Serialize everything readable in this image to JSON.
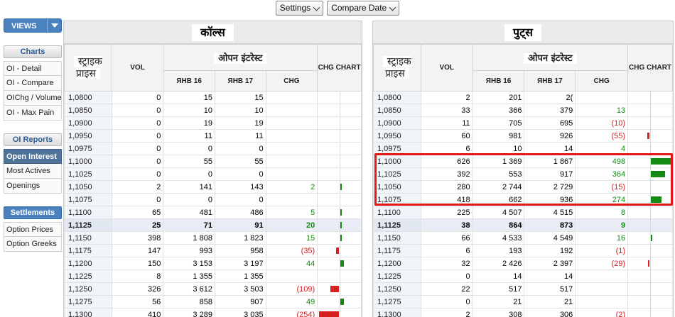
{
  "toolbar": {
    "settings_label": "Settings",
    "compare_label": "Compare Date"
  },
  "sidebar": {
    "views_label": "VIEWS",
    "sections": [
      {
        "title": "Charts",
        "style": "plain",
        "items": [
          "OI - Detail",
          "OI - Compare",
          "OIChg / Volume",
          "OI - Max Pain"
        ]
      },
      {
        "title": "OI Reports",
        "style": "plain",
        "items": [
          "Open Interest",
          "Most Actives",
          "Openings"
        ]
      },
      {
        "title": "Settlements",
        "style": "blue",
        "items": [
          "Option Prices",
          "Option Greeks"
        ]
      }
    ],
    "active_item": "Open Interest"
  },
  "calls": {
    "title": "कॉल्स",
    "headers": {
      "strike": "स्ट्राइक प्राइस",
      "vol": "VOL",
      "oi": "ओपन इंटरेस्ट",
      "m1": "ЯНВ 16",
      "m2": "ЯНВ 17",
      "chg": "CHG",
      "chart": "CHG CHART"
    },
    "rows": [
      {
        "strike": "1,0800",
        "vol": "0",
        "m1": "15",
        "m2": "15",
        "chg": "",
        "dir": ""
      },
      {
        "strike": "1,0850",
        "vol": "0",
        "m1": "10",
        "m2": "10",
        "chg": "",
        "dir": ""
      },
      {
        "strike": "1,0900",
        "vol": "0",
        "m1": "19",
        "m2": "19",
        "chg": "",
        "dir": ""
      },
      {
        "strike": "1,0950",
        "vol": "0",
        "m1": "11",
        "m2": "11",
        "chg": "",
        "dir": ""
      },
      {
        "strike": "1,0975",
        "vol": "0",
        "m1": "0",
        "m2": "0",
        "chg": "",
        "dir": ""
      },
      {
        "strike": "1,1000",
        "vol": "0",
        "m1": "55",
        "m2": "55",
        "chg": "",
        "dir": ""
      },
      {
        "strike": "1,1025",
        "vol": "0",
        "m1": "0",
        "m2": "0",
        "chg": "",
        "dir": ""
      },
      {
        "strike": "1,1050",
        "vol": "2",
        "m1": "141",
        "m2": "143",
        "chg": "2",
        "dir": "pos",
        "mag": 2
      },
      {
        "strike": "1,1075",
        "vol": "0",
        "m1": "0",
        "m2": "0",
        "chg": "",
        "dir": ""
      },
      {
        "strike": "1,1100",
        "vol": "65",
        "m1": "481",
        "m2": "486",
        "chg": "5",
        "dir": "pos",
        "mag": 5
      },
      {
        "strike": "1,1125",
        "vol": "25",
        "m1": "71",
        "m2": "91",
        "chg": "20",
        "dir": "pos",
        "mag": 20,
        "atm": true
      },
      {
        "strike": "1,1150",
        "vol": "398",
        "m1": "1 808",
        "m2": "1 823",
        "chg": "15",
        "dir": "pos",
        "mag": 15
      },
      {
        "strike": "1,1175",
        "vol": "147",
        "m1": "993",
        "m2": "958",
        "chg": "(35)",
        "dir": "neg",
        "mag": 35
      },
      {
        "strike": "1,1200",
        "vol": "150",
        "m1": "3 153",
        "m2": "3 197",
        "chg": "44",
        "dir": "pos",
        "mag": 44
      },
      {
        "strike": "1,1225",
        "vol": "8",
        "m1": "1 355",
        "m2": "1 355",
        "chg": "",
        "dir": ""
      },
      {
        "strike": "1,1250",
        "vol": "326",
        "m1": "3 612",
        "m2": "3 503",
        "chg": "(109)",
        "dir": "neg",
        "mag": 109
      },
      {
        "strike": "1,1275",
        "vol": "56",
        "m1": "858",
        "m2": "907",
        "chg": "49",
        "dir": "pos",
        "mag": 49
      },
      {
        "strike": "1,1300",
        "vol": "410",
        "m1": "3 289",
        "m2": "3 035",
        "chg": "(254)",
        "dir": "neg",
        "mag": 254
      }
    ]
  },
  "puts": {
    "title": "पुट्स",
    "headers": {
      "strike": "स्ट्राइक प्राइस",
      "vol": "VOL",
      "oi": "ओपन इंटरेस्ट",
      "m1": "ЯНВ 16",
      "m2": "ЯНВ 17",
      "chg": "CHG",
      "chart": "CHG CHART"
    },
    "rows": [
      {
        "strike": "1,0800",
        "vol": "2",
        "m1": "201",
        "m2": "2(",
        "chg": "",
        "dir": "",
        "masked": true
      },
      {
        "strike": "1,0850",
        "vol": "33",
        "m1": "366",
        "m2": "379",
        "chg": "13",
        "dir": "pos"
      },
      {
        "strike": "1,0900",
        "vol": "11",
        "m1": "705",
        "m2": "695",
        "chg": "(10)",
        "dir": "neg"
      },
      {
        "strike": "1,0950",
        "vol": "60",
        "m1": "981",
        "m2": "926",
        "chg": "(55)",
        "dir": "neg",
        "mag": 55
      },
      {
        "strike": "1,0975",
        "vol": "6",
        "m1": "10",
        "m2": "14",
        "chg": "4",
        "dir": "pos"
      },
      {
        "strike": "1,1000",
        "vol": "626",
        "m1": "1 369",
        "m2": "1 867",
        "chg": "498",
        "dir": "pos",
        "mag": 498
      },
      {
        "strike": "1,1025",
        "vol": "392",
        "m1": "553",
        "m2": "917",
        "chg": "364",
        "dir": "pos",
        "mag": 364
      },
      {
        "strike": "1,1050",
        "vol": "280",
        "m1": "2 744",
        "m2": "2 729",
        "chg": "(15)",
        "dir": "neg"
      },
      {
        "strike": "1,1075",
        "vol": "418",
        "m1": "662",
        "m2": "936",
        "chg": "274",
        "dir": "pos",
        "mag": 274
      },
      {
        "strike": "1,1100",
        "vol": "225",
        "m1": "4 507",
        "m2": "4 515",
        "chg": "8",
        "dir": "pos"
      },
      {
        "strike": "1,1125",
        "vol": "38",
        "m1": "864",
        "m2": "873",
        "chg": "9",
        "dir": "pos",
        "atm": true
      },
      {
        "strike": "1,1150",
        "vol": "66",
        "m1": "4 533",
        "m2": "4 549",
        "chg": "16",
        "dir": "pos",
        "mag": 16
      },
      {
        "strike": "1,1175",
        "vol": "6",
        "m1": "193",
        "m2": "192",
        "chg": "(1)",
        "dir": "neg"
      },
      {
        "strike": "1,1200",
        "vol": "32",
        "m1": "2 426",
        "m2": "2 397",
        "chg": "(29)",
        "dir": "neg",
        "mag": 29
      },
      {
        "strike": "1,1225",
        "vol": "0",
        "m1": "14",
        "m2": "14",
        "chg": "",
        "dir": ""
      },
      {
        "strike": "1,1250",
        "vol": "22",
        "m1": "517",
        "m2": "517",
        "chg": "",
        "dir": ""
      },
      {
        "strike": "1,1275",
        "vol": "0",
        "m1": "21",
        "m2": "21",
        "chg": "",
        "dir": ""
      },
      {
        "strike": "1,1300",
        "vol": "2",
        "m1": "308",
        "m2": "306",
        "chg": "(2)",
        "dir": "neg"
      }
    ]
  },
  "colors": {
    "positive": "#148a14",
    "negative": "#d42020",
    "highlight_box": "#e21818",
    "accent": "#4a82c0"
  }
}
